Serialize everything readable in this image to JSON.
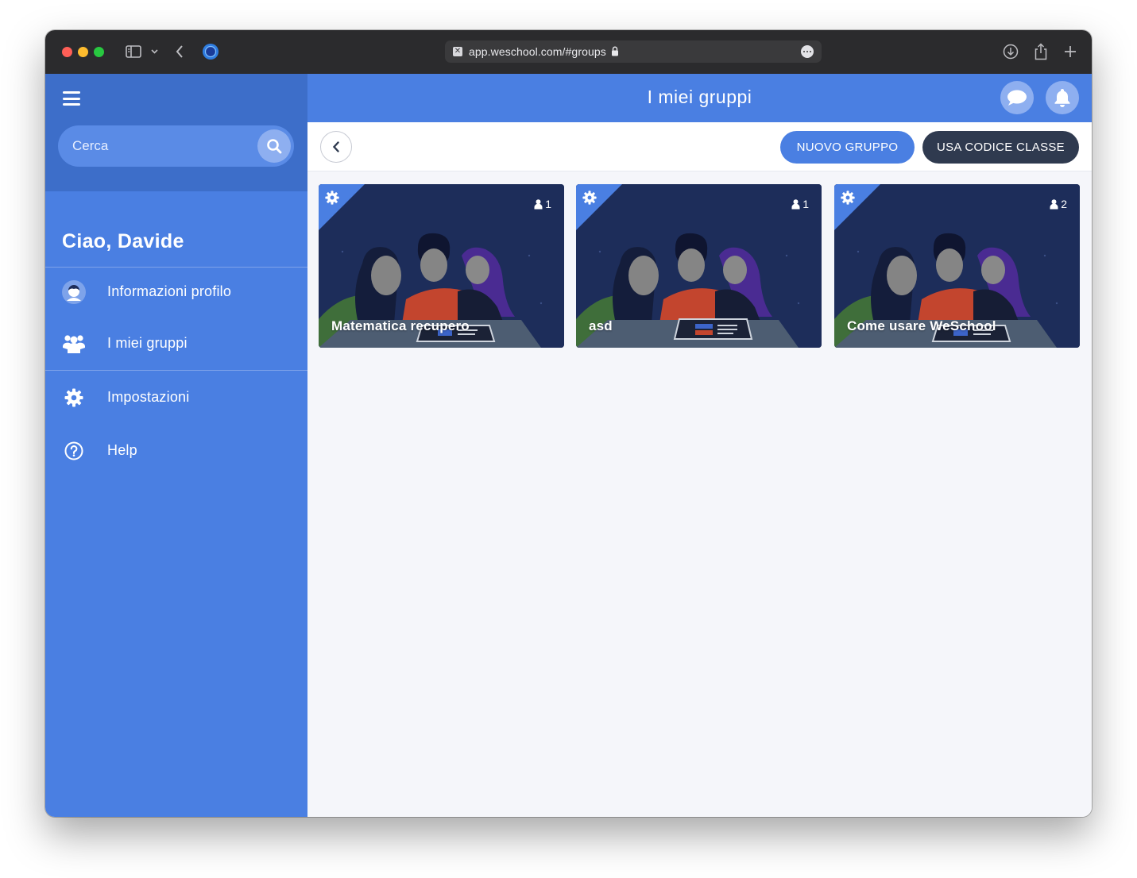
{
  "browser": {
    "url": "app.weschool.com/#groups"
  },
  "sidebar": {
    "search_placeholder": "Cerca",
    "greeting": "Ciao, Davide",
    "items": [
      {
        "label": "Informazioni profilo",
        "icon": "user-avatar-icon"
      },
      {
        "label": "I miei gruppi",
        "icon": "users-icon"
      },
      {
        "label": "Impostazioni",
        "icon": "gear-icon"
      },
      {
        "label": "Help",
        "icon": "question-circle-icon"
      }
    ]
  },
  "header": {
    "title": "I miei gruppi"
  },
  "toolbar": {
    "new_group_label": "NUOVO GRUPPO",
    "class_code_label": "USA CODICE CLASSE"
  },
  "groups": [
    {
      "name": "Matematica recupero",
      "members": "1"
    },
    {
      "name": "asd",
      "members": "1"
    },
    {
      "name": "Come usare WeSchool",
      "members": "2"
    }
  ],
  "colors": {
    "primary": "#4a7fe2",
    "sidebar_top": "#3d6ec9",
    "dark_button": "#2f3a4f",
    "card_background": "#1d2d5a"
  }
}
